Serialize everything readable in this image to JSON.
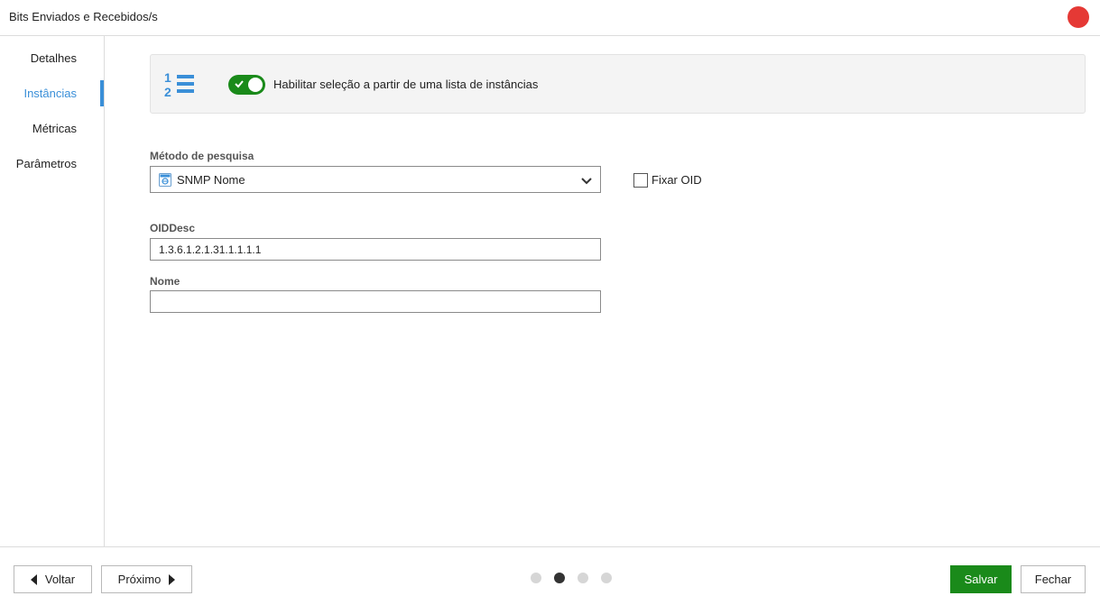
{
  "window": {
    "title": "Bits Enviados e Recebidos/s",
    "close_color": "#e53935"
  },
  "sidebar": {
    "items": [
      {
        "label": "Detalhes",
        "active": false
      },
      {
        "label": "Instâncias",
        "active": true
      },
      {
        "label": "Métricas",
        "active": false
      },
      {
        "label": "Parâmetros",
        "active": false
      }
    ]
  },
  "banner": {
    "icon": "numbered-list-icon",
    "toggle_on": true,
    "toggle_label": "Habilitar seleção a partir de uma lista de instâncias"
  },
  "search_method": {
    "label": "Método de pesquisa",
    "value": "SNMP Nome",
    "icon": "snmp-icon"
  },
  "fix_oid": {
    "label": "Fixar OID",
    "checked": false
  },
  "oid_desc": {
    "label": "OIDDesc",
    "value": "1.3.6.1.2.1.31.1.1.1.1"
  },
  "nome": {
    "label": "Nome",
    "value": ""
  },
  "footer": {
    "back_label": "Voltar",
    "next_label": "Próximo",
    "save_label": "Salvar",
    "close_label": "Fechar",
    "page_count": 4,
    "current_page": 2
  },
  "colors": {
    "accent": "#3a8fd8",
    "primary_green": "#1a8a1a"
  }
}
